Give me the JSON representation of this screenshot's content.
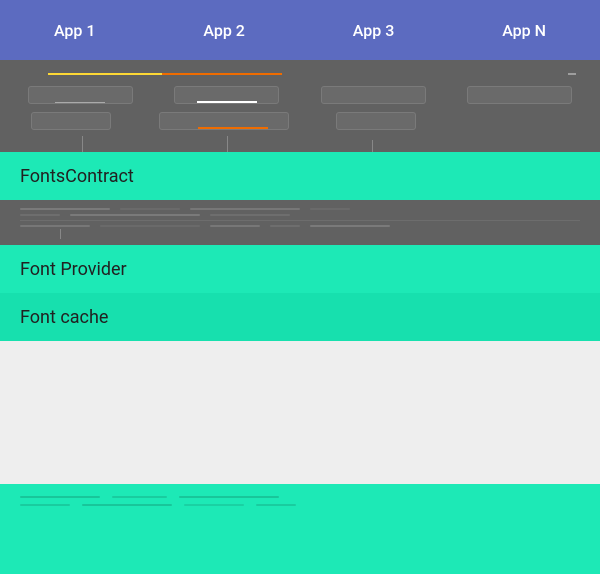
{
  "header": {
    "background": "#5c6bc0",
    "tabs": [
      {
        "label": "App 1"
      },
      {
        "label": "App 2"
      },
      {
        "label": "App 3"
      },
      {
        "label": "App N"
      }
    ]
  },
  "sections": {
    "fontsContract": {
      "label": "FontsContract",
      "background": "#1de9b6"
    },
    "fontProvider": {
      "label": "Font Provider",
      "background": "#1de9b6"
    },
    "fontCache": {
      "label": "Font cache",
      "background": "#1de9b6"
    }
  }
}
